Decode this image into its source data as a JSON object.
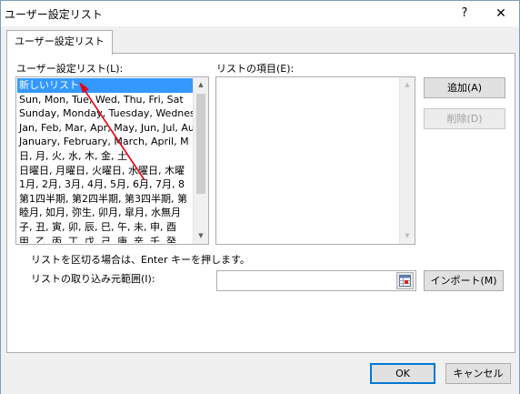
{
  "window": {
    "title": "ユーザー設定リスト",
    "help_glyph": "?",
    "close_glyph": "✕"
  },
  "tabs": [
    {
      "label": "ユーザー設定リスト",
      "active": true
    }
  ],
  "custom_lists": {
    "label": "ユーザー設定リスト(L):",
    "items": [
      "新しいリスト",
      "Sun, Mon, Tue, Wed, Thu, Fri, Sat",
      "Sunday, Monday, Tuesday, Wednesday",
      "Jan, Feb, Mar, Apr, May, Jun, Jul, Au",
      "January, February, March, April, M",
      "日, 月, 火, 水, 木, 金, 土",
      "日曜日, 月曜日, 火曜日, 水曜日, 木曜",
      "1月, 2月, 3月, 4月, 5月, 6月, 7月, 8",
      "第1四半期, 第2四半期, 第3四半期, 第",
      "睦月, 如月, 弥生, 卯月, 皐月, 水無月",
      "子, 丑, 寅, 卯, 辰, 巳, 午, 未, 申, 酉",
      "甲, 乙, 丙, 丁, 戊, 己, 庚, 辛, 壬, 癸"
    ],
    "selected_index": 0
  },
  "list_entries": {
    "label": "リストの項目(E):",
    "value": ""
  },
  "buttons": {
    "add": "追加(A)",
    "delete": "削除(D)",
    "import": "インポート(M)",
    "ok": "OK",
    "cancel": "キャンセル"
  },
  "hint": "リストを区切る場合は、Enter キーを押します。",
  "import_range": {
    "label": "リストの取り込み元範囲(I):",
    "value": ""
  },
  "colors": {
    "selection": "#3399ff",
    "annotation_arrow": "#e60012",
    "default_button_border": "#0078d7"
  },
  "icons": {
    "range_selector": "range-select-icon",
    "annotation": "red-arrow-annotation"
  }
}
